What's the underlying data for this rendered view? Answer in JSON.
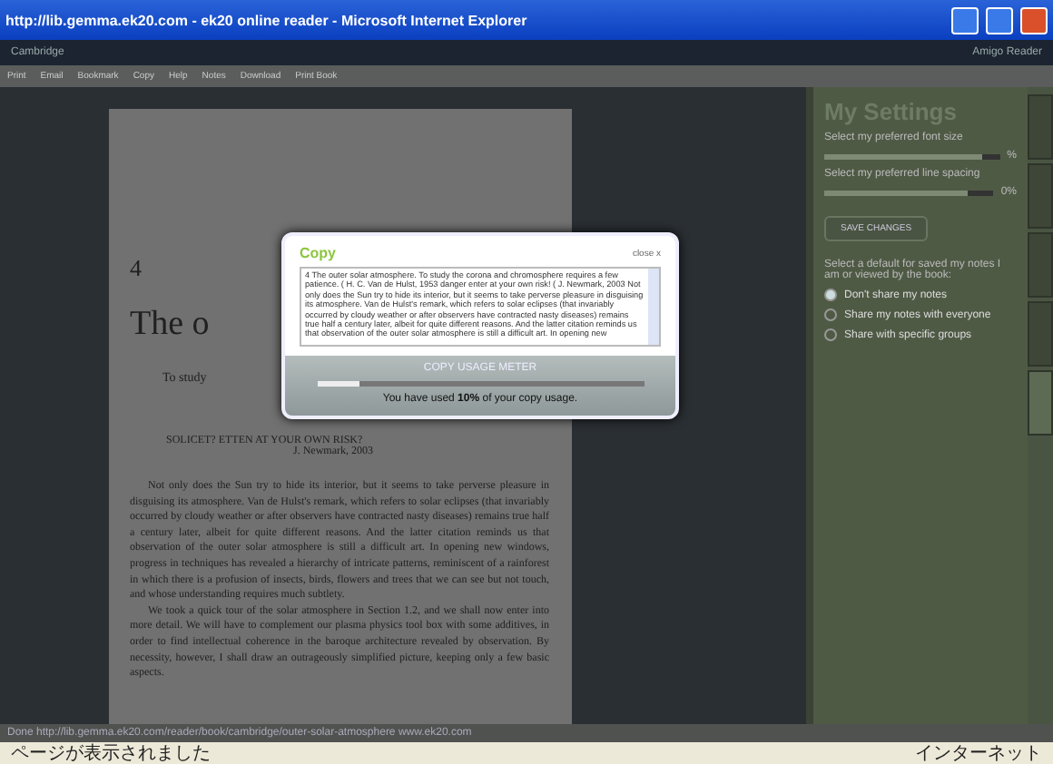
{
  "window": {
    "title": "http://lib.gemma.ek20.com - ek20 online reader - Microsoft Internet Explorer"
  },
  "header": {
    "logo": "Cambridge",
    "user": "Amigo Reader"
  },
  "toolbar": [
    "Print",
    "Email",
    "Bookmark",
    "Copy",
    "Help",
    "Notes",
    "Download",
    "Print Book"
  ],
  "page": {
    "chapter": "4",
    "heading": "The o",
    "intro": "To study",
    "epigraph": "SOLICET? ETTEN AT YOUR OWN RISK?",
    "attribution": "J. Newmark, 2003",
    "paragraphs": [
      "Not only does the Sun try to hide its interior, but it seems to take perverse pleasure in disguising its atmosphere. Van de Hulst's remark, which refers to solar eclipses (that invariably occurred by cloudy weather or after observers have contracted nasty diseases) remains true half a century later, albeit for quite different reasons. And the latter citation reminds us that observation of the outer solar atmosphere is still a difficult art. In opening new windows, progress in techniques has revealed a hierarchy of intricate patterns, reminiscent of a rainforest in which there is a profusion of insects, birds, flowers and trees that we can see but not touch, and whose understanding requires much subtlety.",
      "We took a quick tour of the solar atmosphere in Section 1.2, and we shall now enter into more detail. We will have to complement our plasma physics tool box with some additives, in order to find intellectual coherence in the baroque architecture revealed by observation. By necessity, however, I shall draw an outrageously simplified picture, keeping only a few basic aspects."
    ]
  },
  "copy_dialog": {
    "title": "Copy",
    "close": "close x",
    "text": "4 The outer solar atmosphere. To study the corona and chromosphere requires a few patience. ( H. C. Van de Hulst, 1953 danger enter at your own risk! ( J. Newmark, 2003 Not only does the Sun try to hide its interior, but it seems to take perverse pleasure in disguising its atmosphere. Van de Hulst's remark, which refers to solar eclipses (that invariably occurred by cloudy weather or after observers have contracted nasty diseases) remains true half a century later, albeit for quite different reasons. And the latter citation reminds us that observation of the outer solar atmosphere is still a difficult art. In opening new",
    "meter_label": "COPY USAGE METER",
    "level": 0.13,
    "usage": "You have used **10%** of your copy usage."
  },
  "settings": {
    "title": "My Settings",
    "sliders": [
      {
        "label": "Select my preferred font size",
        "level": 0.9,
        "reading": "%"
      },
      {
        "label": "Select my preferred line spacing",
        "level": 0.85,
        "reading": "0%"
      }
    ],
    "save": "SAVE CHANGES",
    "share_prompt": "Select a default for saved my notes I am or viewed by the book:",
    "options": [
      {
        "label": "Don't share my notes",
        "selected": true
      },
      {
        "label": "Share my notes with everyone",
        "selected": false
      },
      {
        "label": "Share with specific groups",
        "selected": false
      }
    ],
    "side_tabs": [
      {
        "selected": false
      },
      {
        "selected": false
      },
      {
        "selected": false
      },
      {
        "selected": false
      },
      {
        "selected": true
      }
    ]
  },
  "status_link": "Done  http://lib.gemma.ek20.com/reader/book/cambridge/outer-solar-atmosphere  www.ek20.com",
  "ie_status": {
    "left": "ページが表示されました",
    "zone": "インターネット"
  }
}
